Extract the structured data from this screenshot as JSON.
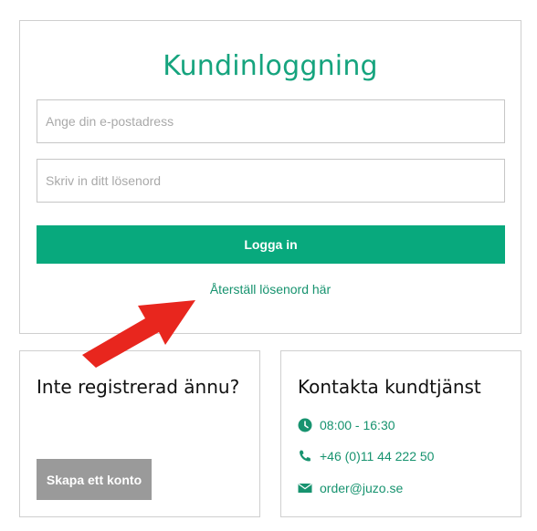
{
  "login": {
    "title": "Kundinloggning",
    "email_placeholder": "Ange din e-postadress",
    "password_placeholder": "Skriv in ditt lösenord",
    "login_button": "Logga in",
    "reset_link": "Återställ lösenord här"
  },
  "register": {
    "title": "Inte registrerad ännu?",
    "create_button": "Skapa ett konto"
  },
  "contact": {
    "title": "Kontakta kundtjänst",
    "hours": "08:00 - 16:30",
    "phone": "+46 (0)11 44 222 50",
    "email": "order@juzo.se",
    "icons": [
      "clock-icon",
      "phone-icon",
      "mail-icon"
    ]
  },
  "colors": {
    "accent": "#08a97d",
    "link": "#17936f",
    "gray_button": "#9a9a9a",
    "arrow": "#e8261e"
  }
}
